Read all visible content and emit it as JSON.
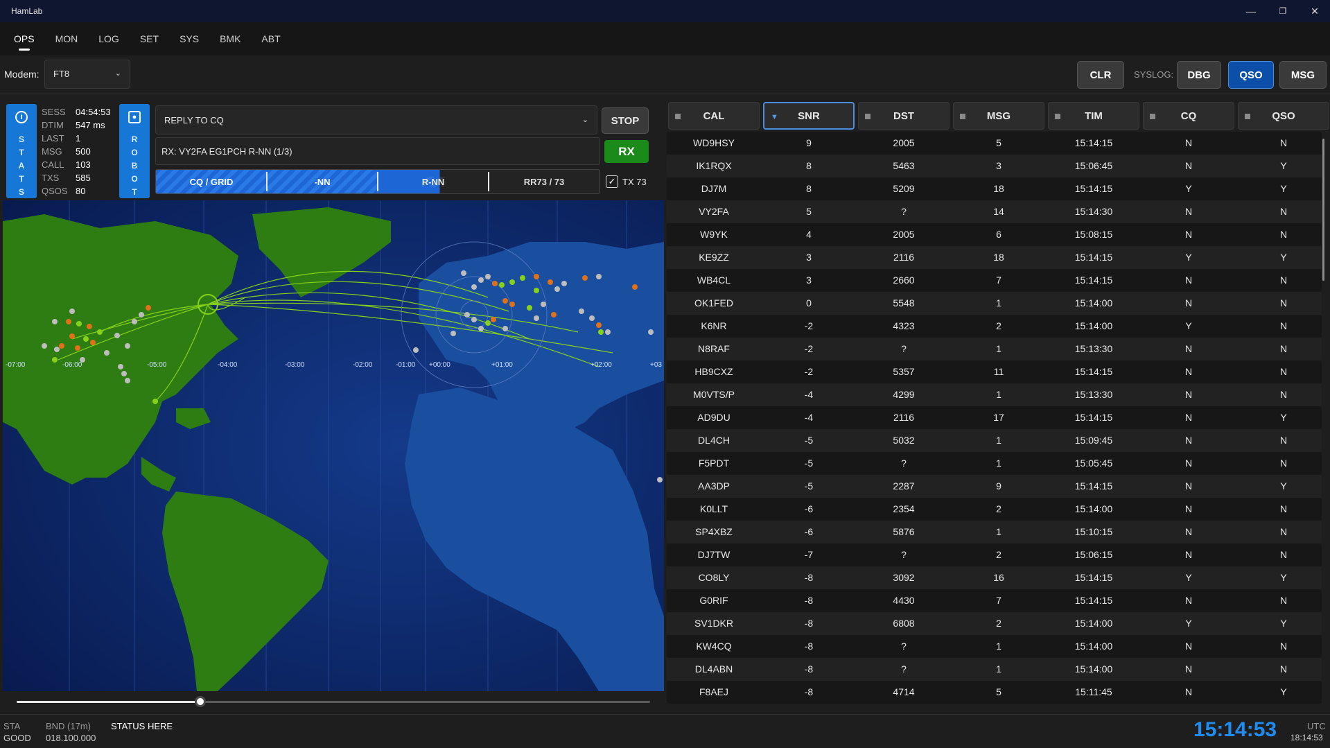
{
  "window": {
    "title": "HamLab"
  },
  "tabs": [
    "OPS",
    "MON",
    "LOG",
    "SET",
    "SYS",
    "BMK",
    "ABT"
  ],
  "toolbar": {
    "modem_label": "Modem:",
    "modem_value": "FT8",
    "clr": "CLR",
    "syslog_label": "SYSLOG:",
    "dbg": "DBG",
    "qso": "QSO",
    "msg": "MSG"
  },
  "stats_bar": {
    "letters": "S\nT\nA\nT\nS"
  },
  "robot_bar": {
    "letters": "R\nO\nB\nO\nT"
  },
  "stats": [
    {
      "k": "SESS",
      "v": "04:54:53"
    },
    {
      "k": "DTIM",
      "v": "547 ms"
    },
    {
      "k": "LAST",
      "v": "1"
    },
    {
      "k": "MSG",
      "v": "500"
    },
    {
      "k": "CALL",
      "v": "103"
    },
    {
      "k": "TXS",
      "v": "585"
    },
    {
      "k": "QSOS",
      "v": "80"
    }
  ],
  "ops": {
    "mode": "REPLY TO CQ",
    "rx_line": "RX: VY2FA EG1PCH R-NN (1/3)",
    "stop": "STOP",
    "rx": "RX",
    "steps": [
      "CQ / GRID",
      "-NN",
      "R-NN",
      "RR73 / 73"
    ],
    "tx73_label": "TX 73",
    "tx73_checked": true
  },
  "map": {
    "timezones": [
      "-07:00",
      "-06:00",
      "-05:00",
      "-04:00",
      "-03:00",
      "-02:00",
      "-01:00",
      "+00:00",
      "+01:00",
      "+02:00",
      "+03"
    ],
    "colors": {
      "ocean": "#0c2260",
      "land_americas": "#2e7d12",
      "land_other": "#1a4fa0",
      "green_spot": "#7ad31a",
      "orange_spot": "#e0701a",
      "gray_spot": "#bdbdbd"
    }
  },
  "time_slider": {
    "position": 0.29
  },
  "table": {
    "headers": [
      "CAL",
      "SNR",
      "DST",
      "MSG",
      "TIM",
      "CQ",
      "QSO"
    ],
    "sorted_column": "SNR",
    "rows": [
      [
        "WD9HSY",
        "9",
        "2005",
        "5",
        "15:14:15",
        "N",
        "N"
      ],
      [
        "IK1RQX",
        "8",
        "5463",
        "3",
        "15:06:45",
        "N",
        "Y"
      ],
      [
        "DJ7M",
        "8",
        "5209",
        "18",
        "15:14:15",
        "Y",
        "Y"
      ],
      [
        "VY2FA",
        "5",
        "?",
        "14",
        "15:14:30",
        "N",
        "N"
      ],
      [
        "W9YK",
        "4",
        "2005",
        "6",
        "15:08:15",
        "N",
        "N"
      ],
      [
        "KE9ZZ",
        "3",
        "2116",
        "18",
        "15:14:15",
        "Y",
        "Y"
      ],
      [
        "WB4CL",
        "3",
        "2660",
        "7",
        "15:14:15",
        "N",
        "N"
      ],
      [
        "OK1FED",
        "0",
        "5548",
        "1",
        "15:14:00",
        "N",
        "N"
      ],
      [
        "K6NR",
        "-2",
        "4323",
        "2",
        "15:14:00",
        "Y",
        "N"
      ],
      [
        "N8RAF",
        "-2",
        "?",
        "1",
        "15:13:30",
        "N",
        "N"
      ],
      [
        "HB9CXZ",
        "-2",
        "5357",
        "11",
        "15:14:15",
        "N",
        "N"
      ],
      [
        "M0VTS/P",
        "-4",
        "4299",
        "1",
        "15:13:30",
        "N",
        "N"
      ],
      [
        "AD9DU",
        "-4",
        "2116",
        "17",
        "15:14:15",
        "N",
        "Y"
      ],
      [
        "DL4CH",
        "-5",
        "5032",
        "1",
        "15:09:45",
        "N",
        "N"
      ],
      [
        "F5PDT",
        "-5",
        "?",
        "1",
        "15:05:45",
        "N",
        "N"
      ],
      [
        "AA3DP",
        "-5",
        "2287",
        "9",
        "15:14:15",
        "N",
        "Y"
      ],
      [
        "K0LLT",
        "-6",
        "2354",
        "2",
        "15:14:00",
        "N",
        "N"
      ],
      [
        "SP4XBZ",
        "-6",
        "5876",
        "1",
        "15:10:15",
        "N",
        "N"
      ],
      [
        "DJ7TW",
        "-7",
        "?",
        "2",
        "15:06:15",
        "N",
        "N"
      ],
      [
        "CO8LY",
        "-8",
        "3092",
        "16",
        "15:14:15",
        "Y",
        "Y"
      ],
      [
        "G0RIF",
        "-8",
        "4430",
        "7",
        "15:14:15",
        "N",
        "N"
      ],
      [
        "SV1DKR",
        "-8",
        "6808",
        "2",
        "15:14:00",
        "Y",
        "Y"
      ],
      [
        "KW4CQ",
        "-8",
        "?",
        "1",
        "15:14:00",
        "N",
        "N"
      ],
      [
        "DL4ABN",
        "-8",
        "?",
        "1",
        "15:14:00",
        "N",
        "N"
      ],
      [
        "F8AEJ",
        "-8",
        "4714",
        "5",
        "15:11:45",
        "N",
        "Y"
      ]
    ]
  },
  "statusbar": {
    "sta_label": "STA",
    "sta_value": "GOOD",
    "band_label": "BND (17m)",
    "band_value": "018.100.000",
    "status_text": "STATUS HERE",
    "clock": "15:14:53",
    "utc_label": "UTC",
    "utc_value": "18:14:53"
  }
}
